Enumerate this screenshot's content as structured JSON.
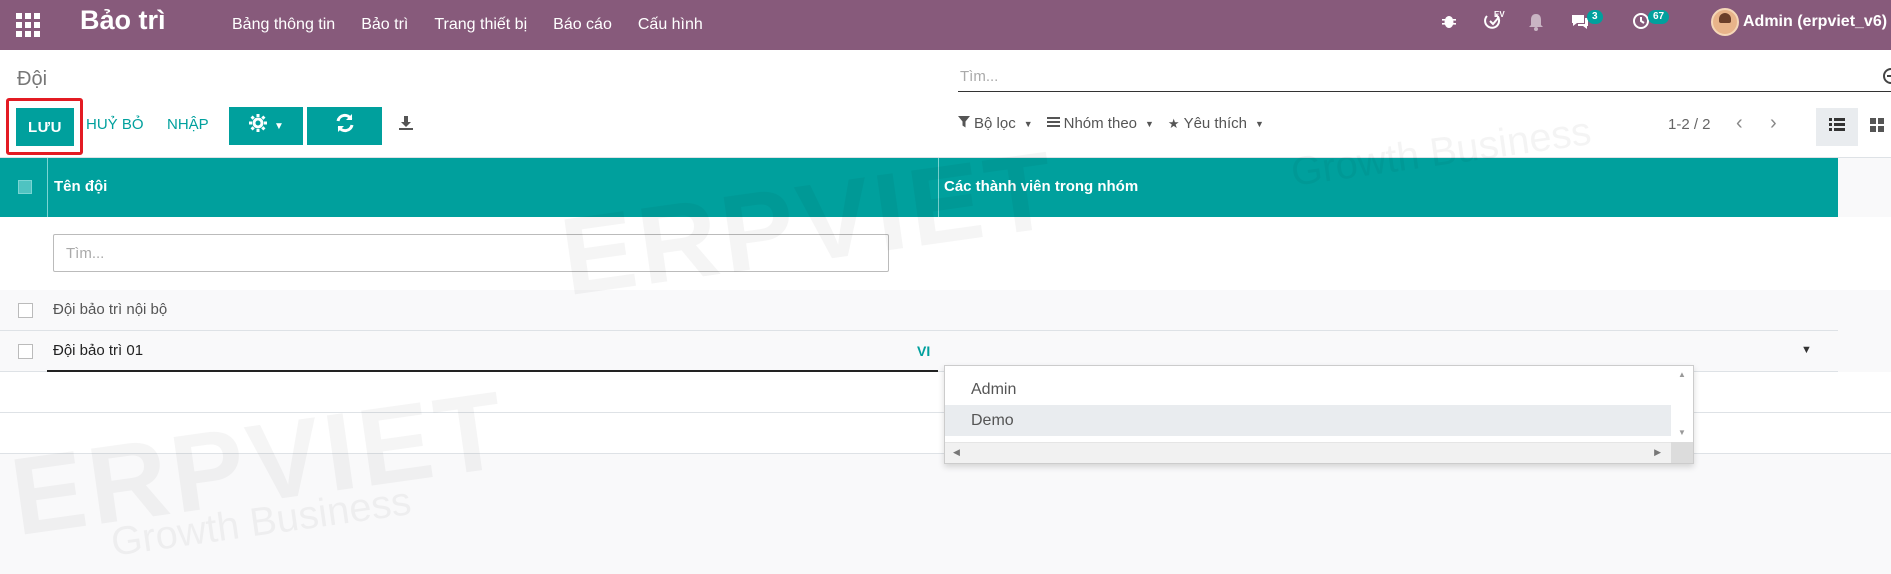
{
  "nav": {
    "brand": "Bảo trì",
    "menu": [
      "Bảng thông tin",
      "Bảo trì",
      "Trang thiết bị",
      "Báo cáo",
      "Cấu hình"
    ],
    "lang_badge": "EV",
    "messages_count": "3",
    "activities_count": "67",
    "user": "Admin (erpviet_v6)"
  },
  "control": {
    "breadcrumb": "Đội",
    "search_placeholder": "Tìm...",
    "save_label": "LƯU",
    "discard_label": "HUỶ BỎ",
    "import_label": "NHẬP",
    "filters_label": "Bộ lọc",
    "groupby_label": "Nhóm theo",
    "favorites_label": "Yêu thích",
    "pager": "1-2 / 2"
  },
  "table": {
    "columns": [
      "Tên đội",
      "Các thành viên trong nhóm"
    ],
    "filter_placeholder": "Tìm...",
    "rows": [
      {
        "name": "Đội bảo trì nội bộ"
      },
      {
        "name": "Đội bảo trì 01",
        "lang": "VI"
      }
    ]
  },
  "dropdown": {
    "options": [
      "Admin",
      "Demo"
    ],
    "highlighted": "Demo"
  },
  "watermark": {
    "text": "ERPVIET",
    "sub": "Growth Business"
  }
}
